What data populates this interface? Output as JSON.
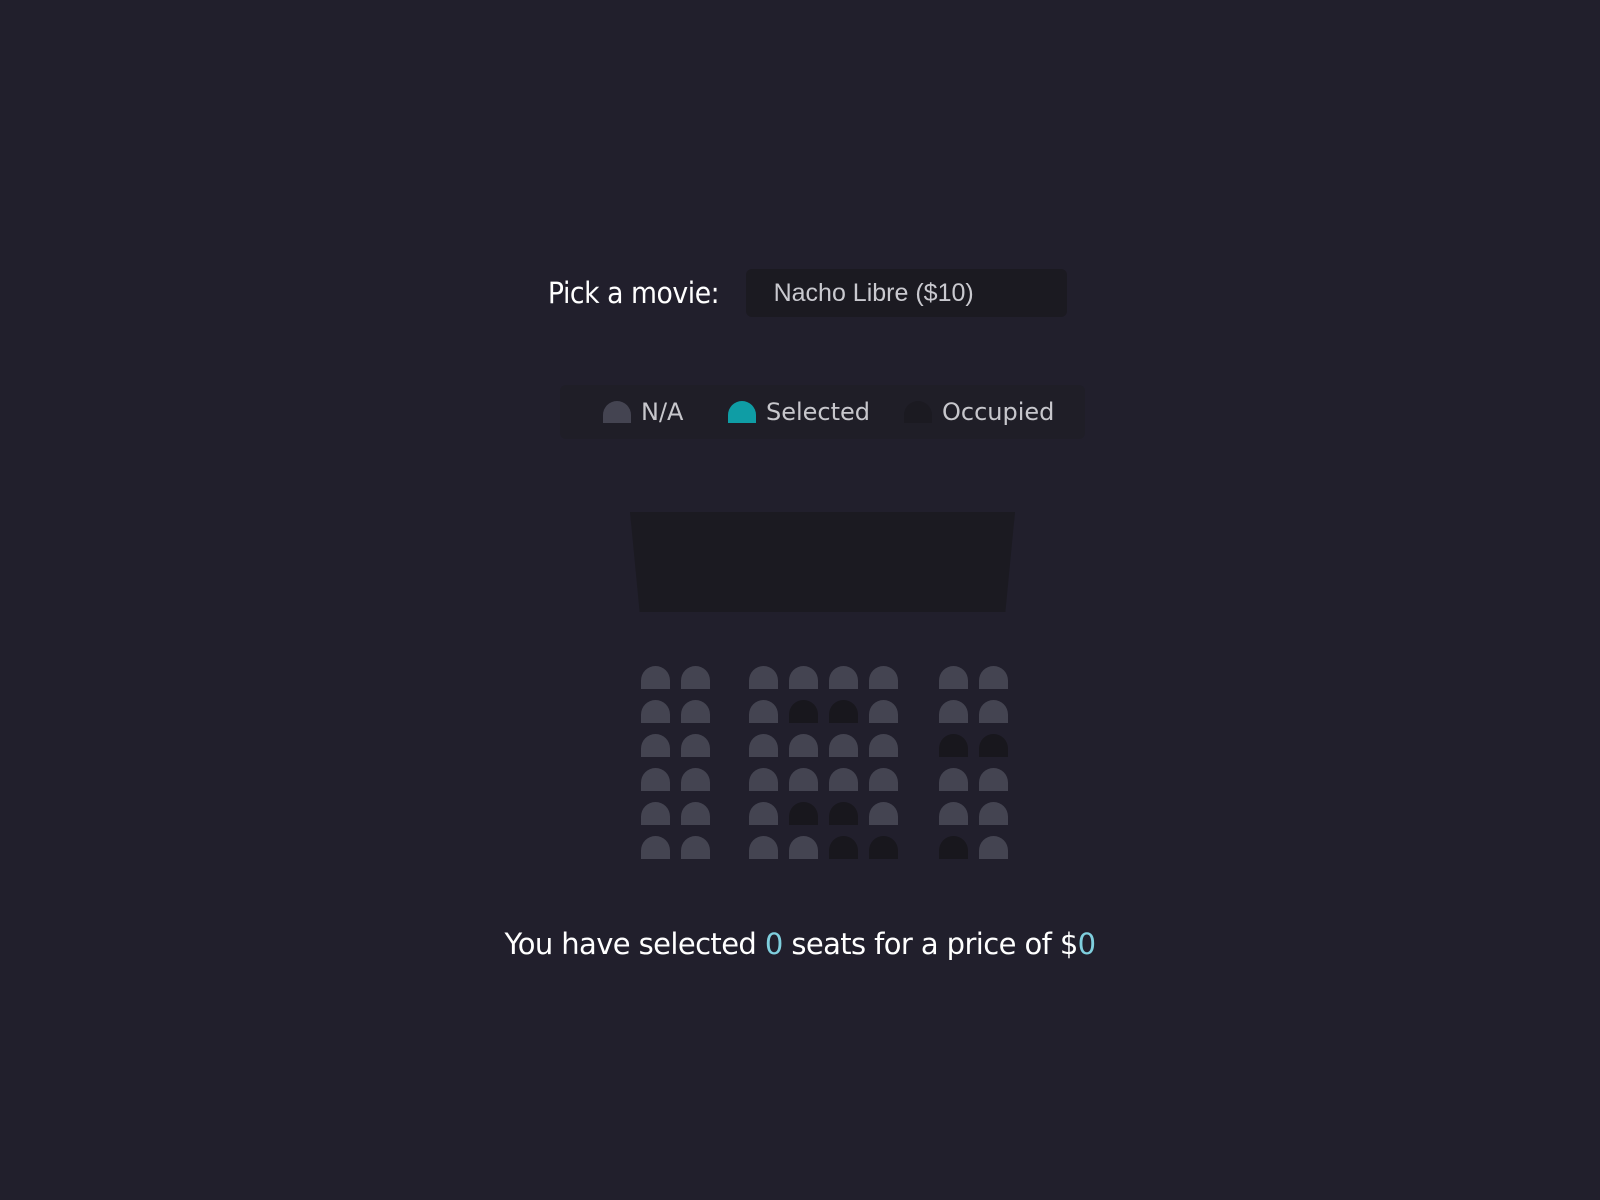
{
  "picker": {
    "label": "Pick a movie:",
    "selected_value": "Nacho Libre ($10)"
  },
  "legend": {
    "na_label": "N/A",
    "selected_label": "Selected",
    "occupied_label": "Occupied"
  },
  "seat_map": {
    "rows": [
      [
        "na",
        "na",
        "na",
        "na",
        "na",
        "na",
        "na",
        "na"
      ],
      [
        "na",
        "na",
        "na",
        "occupied",
        "occupied",
        "na",
        "na",
        "na"
      ],
      [
        "na",
        "na",
        "na",
        "na",
        "na",
        "na",
        "occupied",
        "occupied"
      ],
      [
        "na",
        "na",
        "na",
        "na",
        "na",
        "na",
        "na",
        "na"
      ],
      [
        "na",
        "na",
        "na",
        "occupied",
        "occupied",
        "na",
        "na",
        "na"
      ],
      [
        "na",
        "na",
        "na",
        "na",
        "occupied",
        "occupied",
        "occupied",
        "na"
      ]
    ]
  },
  "summary": {
    "prefix": "You have selected ",
    "count": "0",
    "middle": " seats for a price of $",
    "total": "0"
  },
  "colors": {
    "background": "#211f2c",
    "seat_na": "#444451",
    "seat_selected": "#0f9da5",
    "seat_occupied": "#18171d",
    "accent_text": "#7fcfde"
  }
}
